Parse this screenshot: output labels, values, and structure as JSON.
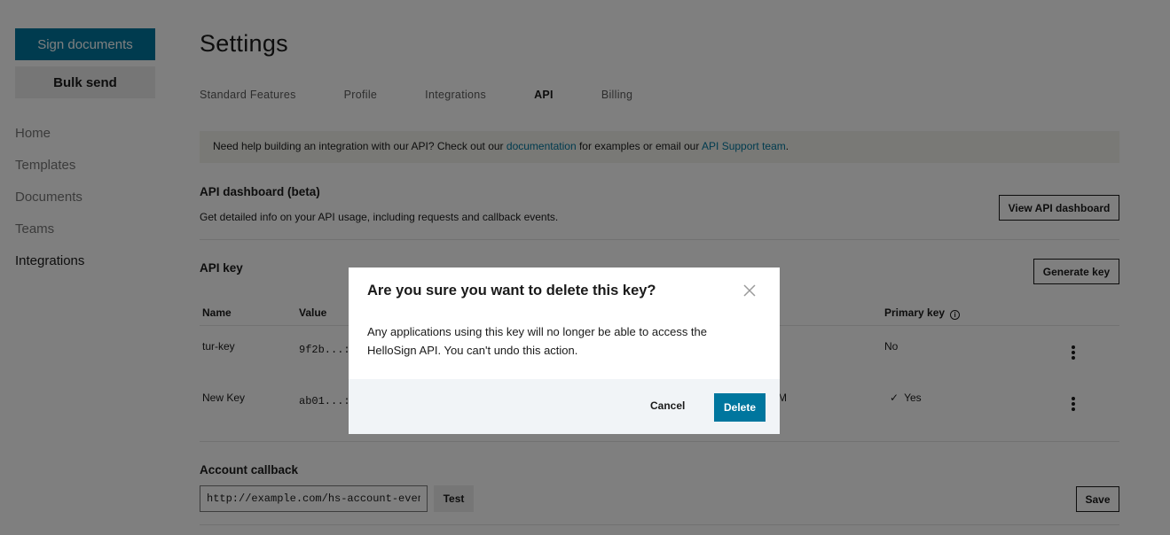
{
  "sidebar": {
    "sign_documents": "Sign documents",
    "bulk_send": "Bulk send",
    "nav": [
      "Home",
      "Templates",
      "Documents",
      "Teams",
      "Integrations"
    ],
    "active_item": "Integrations"
  },
  "page": {
    "title": "Settings",
    "tabs": [
      "Standard Features",
      "Profile",
      "Integrations",
      "API",
      "Billing"
    ],
    "active_tab": "API"
  },
  "banner": {
    "prefix": "Need help building an integration with our API? Check out our ",
    "doc_link": "documentation",
    "middle": " for examples or email our ",
    "support_link": "API Support team",
    "suffix": "."
  },
  "dashboard": {
    "title": "API dashboard (beta)",
    "description": "Get detailed info on your API usage, including requests and callback events.",
    "button": "View API dashboard"
  },
  "api_key": {
    "title": "API key",
    "generate_button": "Generate key",
    "columns": {
      "name": "Name",
      "value": "Value",
      "primary": "Primary key"
    },
    "rows": [
      {
        "name": "tur-key",
        "value": "9f2b...:",
        "date_partial": "",
        "primary": "No"
      },
      {
        "name": "New Key",
        "value": "ab01...:",
        "date_partial": "M",
        "primary": "Yes"
      }
    ]
  },
  "callback": {
    "title": "Account callback",
    "value": "http://example.com/hs-account-events",
    "test_button": "Test",
    "save_button": "Save"
  },
  "modal": {
    "title": "Are you sure you want to delete this key?",
    "body": "Any applications using this key will no longer be able to access the HelloSign API. You can't undo this action.",
    "cancel": "Cancel",
    "delete": "Delete"
  },
  "colors": {
    "accent": "#00769e",
    "overlay": "rgba(0,0,0,0.5)"
  }
}
